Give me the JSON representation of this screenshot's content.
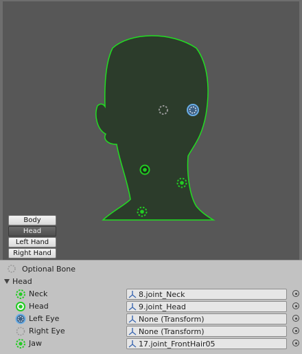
{
  "modes": [
    {
      "label": "Body",
      "active": false
    },
    {
      "label": "Head",
      "active": true
    },
    {
      "label": "Left Hand",
      "active": false
    },
    {
      "label": "Right Hand",
      "active": false
    }
  ],
  "legend": {
    "optional_label": "Optional Bone"
  },
  "group": {
    "label": "Head",
    "expanded": true
  },
  "bones": [
    {
      "name": "Neck",
      "value": "8.joint_Neck",
      "icon": "required-bone-dashed-icon"
    },
    {
      "name": "Head",
      "value": "9.joint_Head",
      "icon": "required-bone-solid-icon"
    },
    {
      "name": "Left Eye",
      "value": "None (Transform)",
      "icon": "selected-optional-bone-icon"
    },
    {
      "name": "Right Eye",
      "value": "None (Transform)",
      "icon": "optional-bone-icon"
    },
    {
      "name": "Jaw",
      "value": "17.joint_FrontHair05",
      "icon": "required-bone-dashed-icon"
    }
  ],
  "colors": {
    "viewport_bg": "#575757",
    "head_fill": "#2c3c2b",
    "head_outline": "#22dd22",
    "bone_green": "#22cc22",
    "selected_blue": "#6aaee6",
    "optional_grey": "#9a9a9a",
    "panel_bg": "#c2c2c2"
  }
}
